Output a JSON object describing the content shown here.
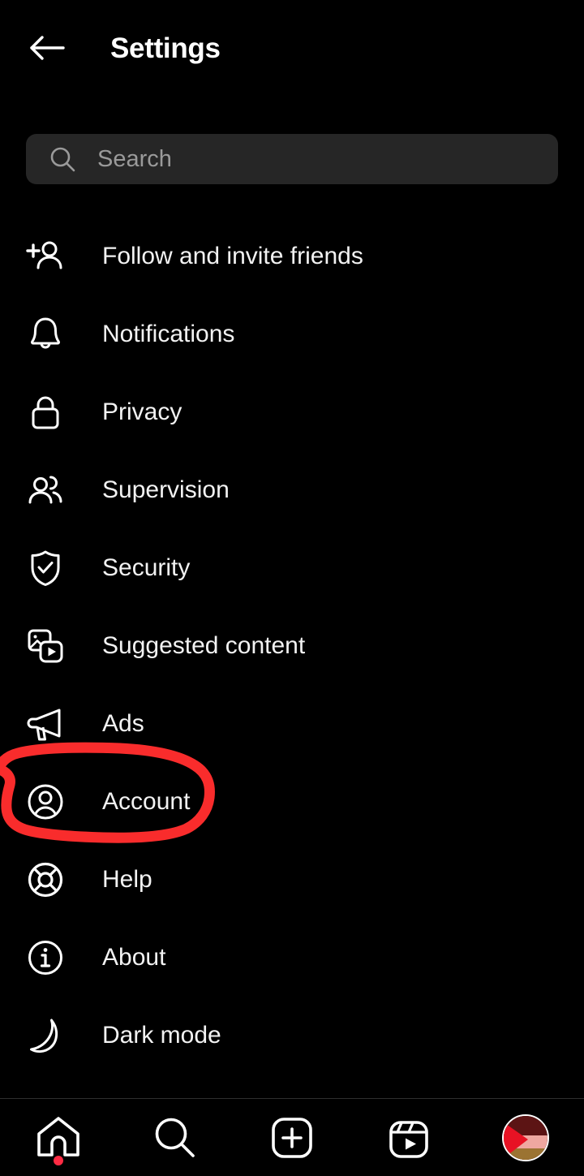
{
  "header": {
    "title": "Settings",
    "back_icon": "back-arrow-icon"
  },
  "search": {
    "placeholder": "Search",
    "value": "",
    "icon": "search-icon"
  },
  "menu": {
    "items": [
      {
        "label": "Follow and invite friends",
        "icon": "person-add-icon"
      },
      {
        "label": "Notifications",
        "icon": "bell-icon"
      },
      {
        "label": "Privacy",
        "icon": "lock-icon"
      },
      {
        "label": "Supervision",
        "icon": "two-people-icon"
      },
      {
        "label": "Security",
        "icon": "shield-check-icon"
      },
      {
        "label": "Suggested content",
        "icon": "media-cards-icon"
      },
      {
        "label": "Ads",
        "icon": "megaphone-icon"
      },
      {
        "label": "Account",
        "icon": "account-circle-icon"
      },
      {
        "label": "Help",
        "icon": "life-ring-icon"
      },
      {
        "label": "About",
        "icon": "info-circle-icon"
      },
      {
        "label": "Dark mode",
        "icon": "moon-icon"
      }
    ]
  },
  "annotation": {
    "target_label": "Account",
    "shape": "hand-drawn-circle",
    "color": "#f92c2c"
  },
  "bottom_nav": {
    "items": [
      {
        "name": "home",
        "icon": "home-icon",
        "badge": true
      },
      {
        "name": "search",
        "icon": "search-icon",
        "badge": false
      },
      {
        "name": "create",
        "icon": "plus-square-icon",
        "badge": false
      },
      {
        "name": "reels",
        "icon": "reels-icon",
        "badge": false
      },
      {
        "name": "profile",
        "icon": "avatar-icon",
        "badge": false
      }
    ],
    "badge_color": "#ff2b43"
  },
  "colors": {
    "background": "#000000",
    "search_bar": "#262626",
    "text_primary": "#f2f2f2",
    "text_placeholder": "#9a9a9a",
    "divider": "#2e2e2e",
    "annotation_red": "#f92c2c",
    "avatar_maroon": "#5c1414",
    "avatar_red": "#e81224",
    "avatar_pink": "#efa7a0",
    "avatar_brown": "#9b7332"
  }
}
